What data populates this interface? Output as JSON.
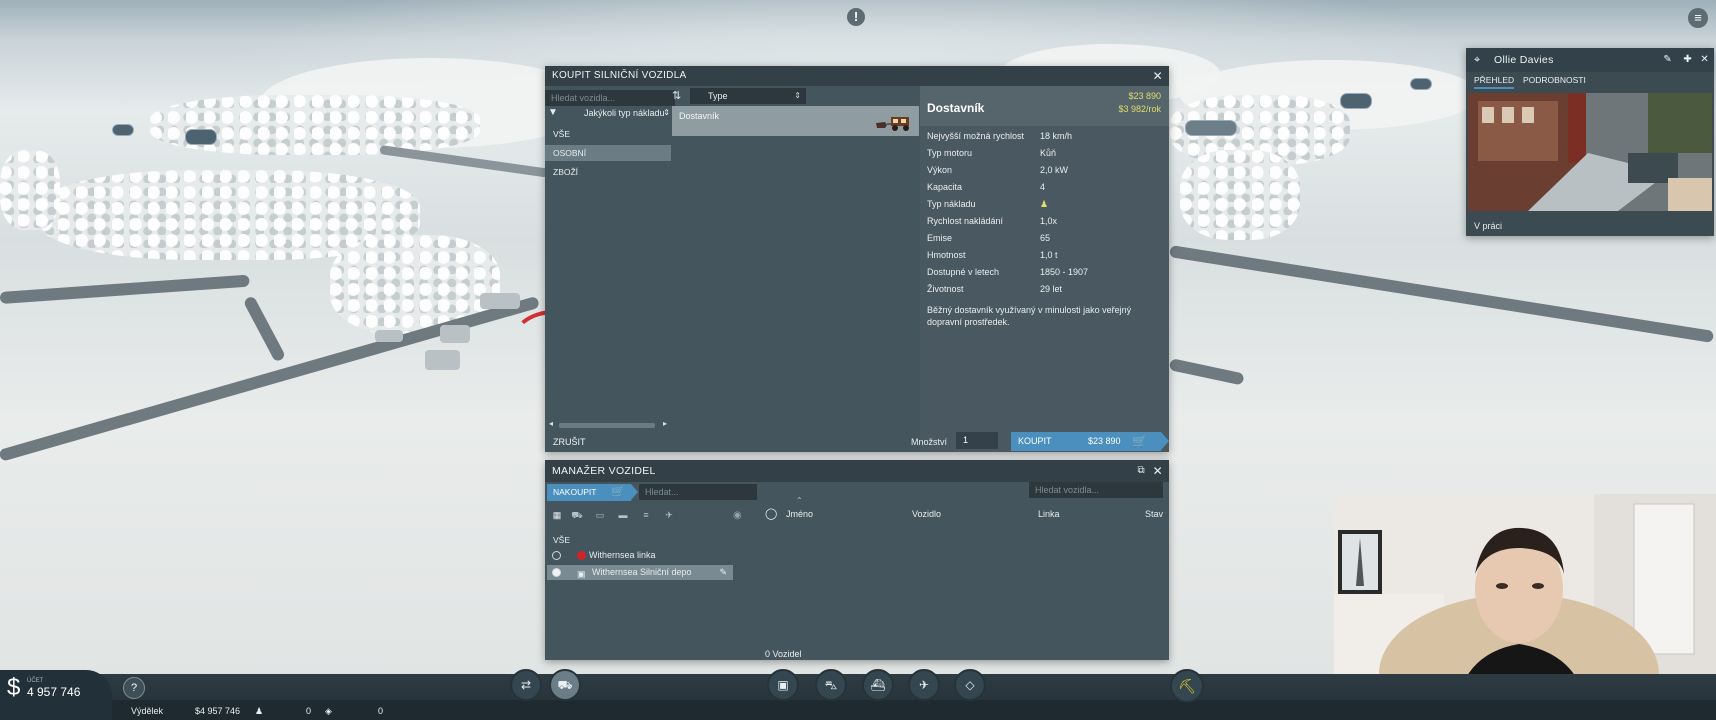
{
  "buy_window": {
    "title": "KOUPIT SILNIČNÍ VOZIDLA",
    "search_placeholder": "Hledat vozidla...",
    "type_label": "Type",
    "cargo_filter": "Jakýkoli typ nákladu",
    "categories": [
      "VŠE",
      "OSOBNÍ",
      "ZBOŽÍ"
    ],
    "active_category": "OSOBNÍ",
    "vehicle": {
      "name": "Dostavník",
      "price": "$23 890",
      "running_cost": "$3 982/rok",
      "specs": [
        {
          "label": "Nejvyšší možná rychlost",
          "value": "18 km/h"
        },
        {
          "label": "Typ motoru",
          "value": "Kůň"
        },
        {
          "label": "Výkon",
          "value": "2,0 kW"
        },
        {
          "label": "Kapacita",
          "value": "4"
        },
        {
          "label": "Typ nákladu",
          "value": ""
        },
        {
          "label": "Rychlost nakládání",
          "value": "1,0x"
        },
        {
          "label": "Emise",
          "value": "65"
        },
        {
          "label": "Hmotnost",
          "value": "1,0 t"
        },
        {
          "label": "Dostupné v letech",
          "value": "1850 - 1907"
        },
        {
          "label": "Životnost",
          "value": "29 let"
        }
      ],
      "description": "Běžný dostavník využívaný v minulosti jako veřejný dopravní prostředek."
    },
    "cancel_label": "ZRUŠIT",
    "quantity_label": "Množství",
    "quantity_value": "1",
    "buy_label": "KOUPIT",
    "buy_price": "$23 890"
  },
  "manager": {
    "title": "MANAŽER VOZIDEL",
    "buy_tab": "NAKOUPIT",
    "search_placeholder": "Hledat...",
    "vehicle_search_placeholder": "Hledat vozidla...",
    "all_label": "VŠE",
    "lines": [
      {
        "name": "Withernsea linka",
        "type": "line"
      },
      {
        "name": "Withernsea Silniční depo",
        "type": "depot"
      }
    ],
    "columns": [
      "Jméno",
      "Vozidlo",
      "Linka",
      "Stav"
    ],
    "count": "0 Vozidel"
  },
  "character_card": {
    "name": "Ollie Davies",
    "tabs": [
      "PŘEHLED",
      "PODROBNOSTI"
    ],
    "active_tab": "PŘEHLED",
    "status": "V práci"
  },
  "status_bar": {
    "balance_label": "ÚČET",
    "balance": "4 957 746",
    "expense_label": "Výdělek",
    "expense_value": "$4 957 746",
    "stat1": "0",
    "stat2": "0"
  },
  "colors": {
    "accent": "#4b8fbf",
    "price": "#e1dc6a",
    "line_red": "#d0242a"
  },
  "icons": [
    "info-icon",
    "menu-icon",
    "filter-icon",
    "sort-icon",
    "cart-icon",
    "pin-icon",
    "edit-icon",
    "close-icon",
    "popout-icon",
    "eye-icon",
    "refresh-icon",
    "help-icon",
    "bulldozer-icon"
  ]
}
